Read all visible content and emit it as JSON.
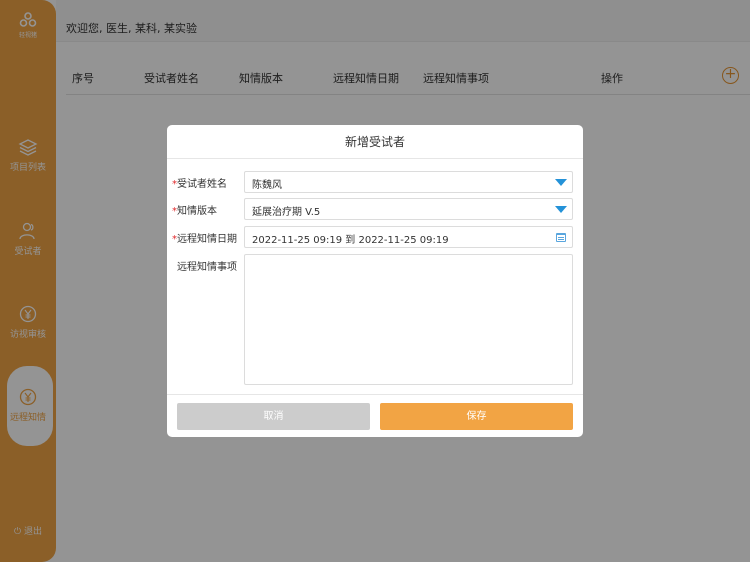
{
  "sidebar": {
    "logo_text": "轻视猪",
    "items": [
      {
        "label": "项目列表",
        "icon": "layers-icon"
      },
      {
        "label": "受试者",
        "icon": "users-icon"
      },
      {
        "label": "访视审核",
        "icon": "yen-coin-icon"
      },
      {
        "label": "远程知情",
        "icon": "yen-coin-icon",
        "active": true
      }
    ],
    "logout_label": "退出"
  },
  "header": {
    "welcome": "欢迎您, 医生, 某科, 某实验"
  },
  "table": {
    "columns": [
      "序号",
      "受试者姓名",
      "知情版本",
      "远程知情日期",
      "远程知情事项",
      "操作"
    ],
    "add_icon": "plus-circle-icon"
  },
  "dialog": {
    "title": "新增受试者",
    "fields": [
      {
        "label": "受试者姓名",
        "required": true,
        "value": "陈魏风",
        "control": "select"
      },
      {
        "label": "知情版本",
        "required": true,
        "value": "延展治疗期 V.5",
        "control": "select"
      },
      {
        "label": "远程知情日期",
        "required": true,
        "value": "2022-11-25 09:19 到 2022-11-25 09:19",
        "control": "date-range"
      }
    ],
    "notes_label": "远程知情事项",
    "notes_value": "",
    "cancel_label": "取消",
    "save_label": "保存"
  },
  "colors": {
    "accent": "#f0a446",
    "save": "#f2a444",
    "cancel": "#cccccc",
    "required": "#e0282b",
    "dropdown_arrow": "#2492d8"
  }
}
